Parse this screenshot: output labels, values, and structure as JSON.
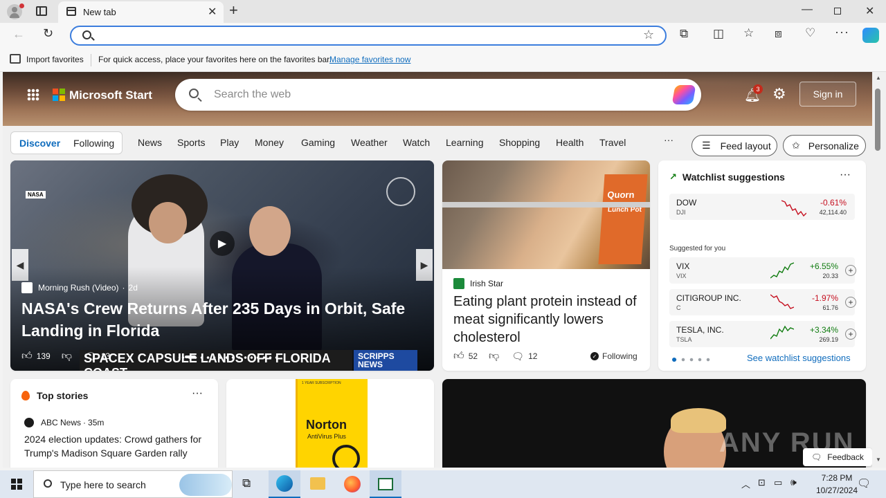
{
  "browser": {
    "tab_title": "New tab",
    "address_placeholder": "",
    "favbar": {
      "import_label": "Import favorites",
      "message": "For quick access, place your favorites here on the favorites bar.",
      "manage_link": "Manage favorites now"
    }
  },
  "header": {
    "brand": "Microsoft Start",
    "search_placeholder": "Search the web",
    "notification_count": "3",
    "signin": "Sign in"
  },
  "nav": {
    "discover": "Discover",
    "following": "Following",
    "links": [
      "News",
      "Sports",
      "Play",
      "Money",
      "Gaming",
      "Weather",
      "Watch",
      "Learning",
      "Shopping",
      "Health",
      "Travel"
    ],
    "more": "···",
    "feed_layout": "Feed layout",
    "personalize": "Personalize"
  },
  "main_story": {
    "source": "Morning Rush (Video)",
    "age": "2d",
    "title": "NASA's Crew Returns After 235 Days in Orbit, Safe Landing in Florida",
    "likes": "139",
    "comments": "13",
    "nasa_logo": "NASA",
    "caption": "SPACEX CAPSULE LANDS OFF FLORIDA COAST",
    "caption2": "IN FLORIDA EARLY THIS MORNING",
    "network": "SCRIPPS NEWS"
  },
  "story2": {
    "source": "Irish Star",
    "title": "Eating plant protein instead of meat significantly lowers cholesterol",
    "likes": "52",
    "comments": "12",
    "following": "Following",
    "pack_brand": "Quorn",
    "pack_text": "Lunch Pot"
  },
  "watchlist": {
    "title": "Watchlist suggestions",
    "index": {
      "name": "DOW",
      "symbol": "DJI",
      "change": "-0.61%",
      "price": "42,114.40"
    },
    "suggested_label": "Suggested for you",
    "stocks": [
      {
        "name": "VIX",
        "symbol": "VIX",
        "change": "+6.55%",
        "price": "20.33",
        "up": true
      },
      {
        "name": "CITIGROUP INC.",
        "symbol": "C",
        "change": "-1.97%",
        "price": "61.76",
        "up": false
      },
      {
        "name": "TESLA, INC.",
        "symbol": "TSLA",
        "change": "+3.34%",
        "price": "269.19",
        "up": true
      }
    ],
    "see_more": "See watchlist suggestions",
    "colors": {
      "up": "#107c10",
      "down": "#c50f1f"
    }
  },
  "top_stories": {
    "title": "Top stories",
    "source": "ABC News",
    "age": "35m",
    "headline": "2024 election updates: Crowd gathers for Trump's Madison Square Garden rally"
  },
  "ad": {
    "product": "Norton",
    "subtitle": "AntiVirus Plus",
    "badge": "1 YEAR SUBSCRIPTION"
  },
  "feedback": "Feedback",
  "watermark": "ANY RUN",
  "taskbar": {
    "search_placeholder": "Type here to search",
    "time": "7:28 PM",
    "date": "10/27/2024"
  }
}
